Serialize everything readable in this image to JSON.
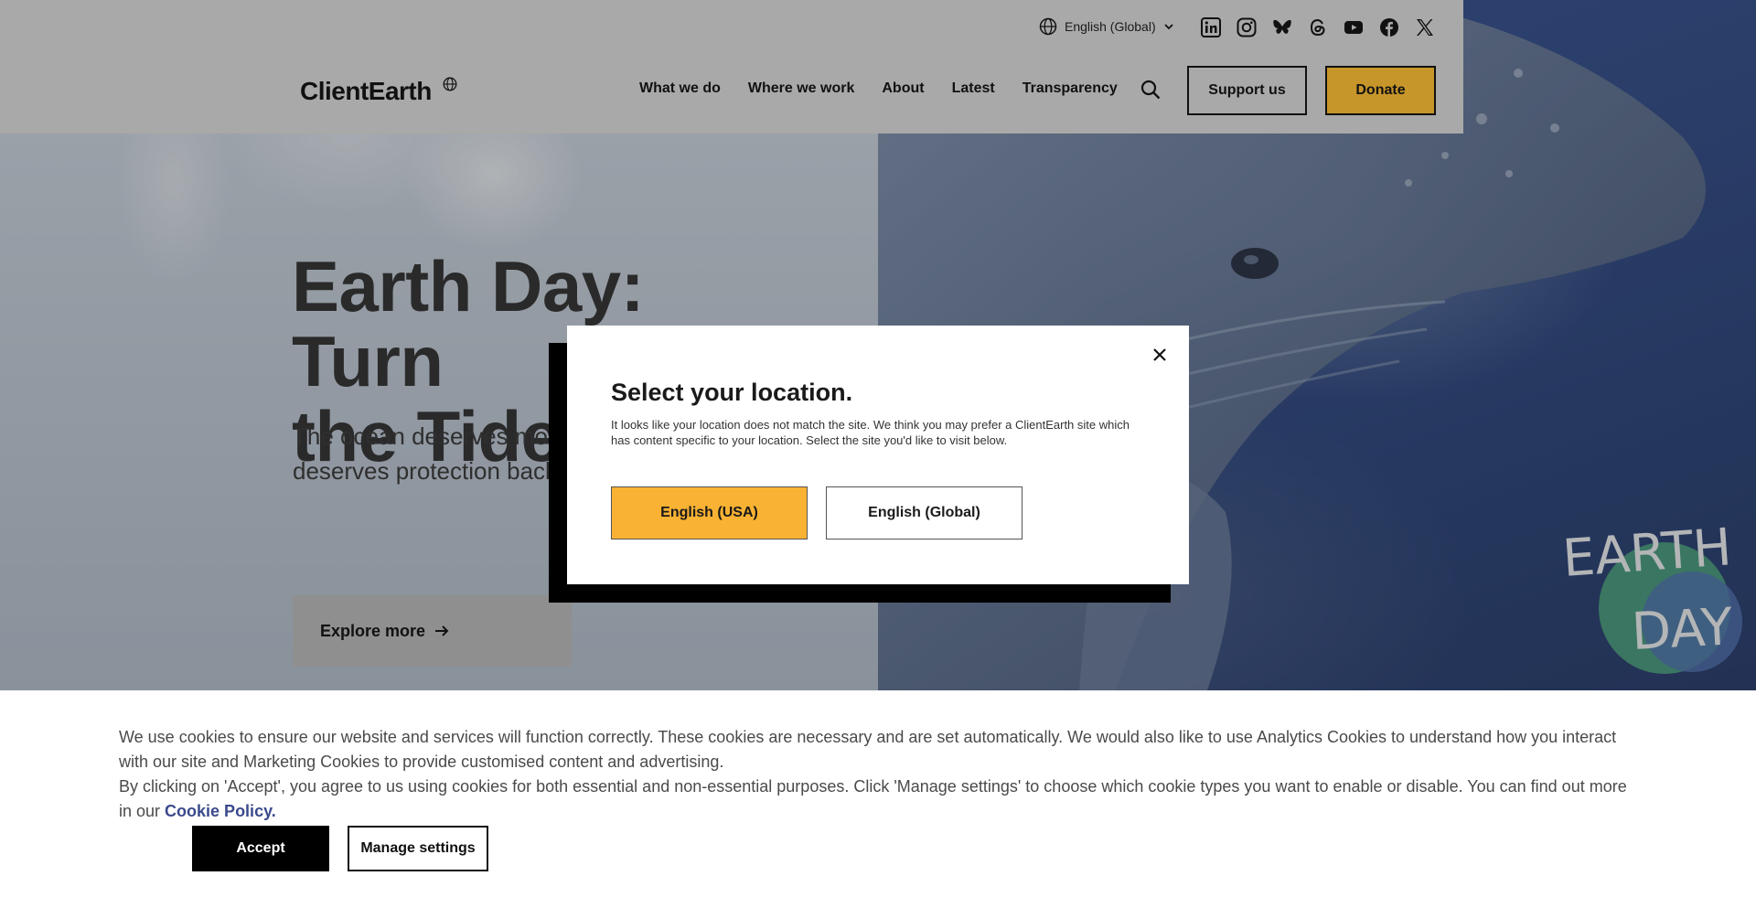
{
  "header": {
    "language_selector": "English (Global)",
    "logo": "ClientEarth",
    "nav": [
      "What we do",
      "Where we work",
      "About",
      "Latest",
      "Transparency"
    ],
    "support_label": "Support us",
    "donate_label": "Donate",
    "socials": [
      "linkedin-icon",
      "instagram-icon",
      "bluesky-icon",
      "threads-icon",
      "youtube-icon",
      "facebook-icon",
      "x-icon"
    ]
  },
  "hero": {
    "title_line1": "Earth Day: Turn",
    "title_line2": "the Tide",
    "subtitle_line1": "The ocean deserves more",
    "subtitle_line2": "deserves protection back",
    "cta_label": "Explore more",
    "artwork_text": [
      "EARTH",
      "DAY"
    ]
  },
  "location_modal": {
    "title": "Select your location.",
    "body": "It looks like your location does not match the site. We think you may prefer a ClientEarth site which has content specific to your location. Select the site you'd like to visit below.",
    "option_usa": "English (USA)",
    "option_global": "English (Global)"
  },
  "cookie_banner": {
    "paragraph1": "We use cookies to ensure our website and services will function correctly. These cookies are necessary and are set automatically. We would also like to use Analytics Cookies to understand how you interact with our site and Marketing Cookies to provide customised content and advertising.",
    "paragraph2": "By clicking on 'Accept', you agree to us using cookies for both essential and non-essential purposes. Click 'Manage settings' to choose which cookie types you want to enable or disable. You can find out more in our",
    "policy_link": "Cookie Policy.",
    "accept_label": "Accept",
    "manage_label": "Manage settings"
  },
  "colors": {
    "donate": "#c7962a",
    "usa_button": "#f9b233",
    "link": "#3b4a8c",
    "header_bg": "#a9a9a9"
  }
}
